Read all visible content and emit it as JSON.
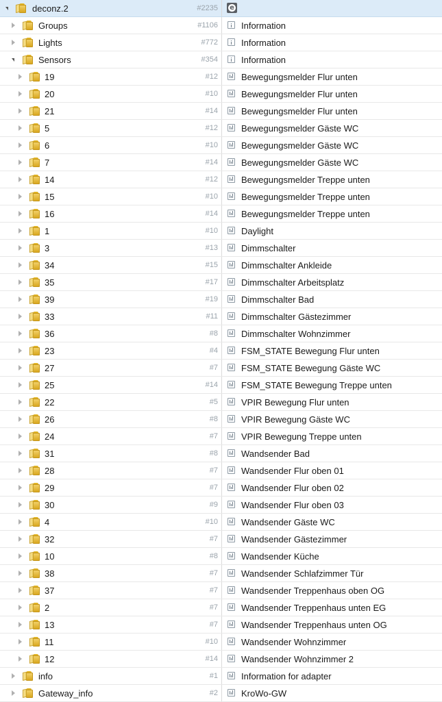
{
  "tree": [
    {
      "name": "deconz.2",
      "count": "#2235",
      "title": "",
      "title_icon": "deconz-logo-icon",
      "level": 0,
      "expanded": true,
      "selected": true
    },
    {
      "name": "Groups",
      "count": "#1106",
      "title": "Information",
      "title_icon": "info-icon",
      "level": 1,
      "expanded": false
    },
    {
      "name": "Lights",
      "count": "#772",
      "title": "Information",
      "title_icon": "info-icon",
      "level": 1,
      "expanded": false
    },
    {
      "name": "Sensors",
      "count": "#354",
      "title": "Information",
      "title_icon": "info-icon",
      "level": 1,
      "expanded": true
    },
    {
      "name": "19",
      "count": "#12",
      "title": "Bewegungsmelder Flur unten",
      "title_icon": "channel-icon",
      "level": 2
    },
    {
      "name": "20",
      "count": "#10",
      "title": "Bewegungsmelder Flur unten",
      "title_icon": "channel-icon",
      "level": 2
    },
    {
      "name": "21",
      "count": "#14",
      "title": "Bewegungsmelder Flur unten",
      "title_icon": "channel-icon",
      "level": 2
    },
    {
      "name": "5",
      "count": "#12",
      "title": "Bewegungsmelder Gäste WC",
      "title_icon": "channel-icon",
      "level": 2
    },
    {
      "name": "6",
      "count": "#10",
      "title": "Bewegungsmelder Gäste WC",
      "title_icon": "channel-icon",
      "level": 2
    },
    {
      "name": "7",
      "count": "#14",
      "title": "Bewegungsmelder Gäste WC",
      "title_icon": "channel-icon",
      "level": 2
    },
    {
      "name": "14",
      "count": "#12",
      "title": "Bewegungsmelder Treppe unten",
      "title_icon": "channel-icon",
      "level": 2
    },
    {
      "name": "15",
      "count": "#10",
      "title": "Bewegungsmelder Treppe unten",
      "title_icon": "channel-icon",
      "level": 2
    },
    {
      "name": "16",
      "count": "#14",
      "title": "Bewegungsmelder Treppe unten",
      "title_icon": "channel-icon",
      "level": 2
    },
    {
      "name": "1",
      "count": "#10",
      "title": "Daylight",
      "title_icon": "channel-icon",
      "level": 2
    },
    {
      "name": "3",
      "count": "#13",
      "title": "Dimmschalter",
      "title_icon": "channel-icon",
      "level": 2
    },
    {
      "name": "34",
      "count": "#15",
      "title": "Dimmschalter Ankleide",
      "title_icon": "channel-icon",
      "level": 2
    },
    {
      "name": "35",
      "count": "#17",
      "title": "Dimmschalter Arbeitsplatz",
      "title_icon": "channel-icon",
      "level": 2
    },
    {
      "name": "39",
      "count": "#19",
      "title": "Dimmschalter Bad",
      "title_icon": "channel-icon",
      "level": 2
    },
    {
      "name": "33",
      "count": "#11",
      "title": "Dimmschalter Gästezimmer",
      "title_icon": "channel-icon",
      "level": 2
    },
    {
      "name": "36",
      "count": "#8",
      "title": "Dimmschalter Wohnzimmer",
      "title_icon": "channel-icon",
      "level": 2
    },
    {
      "name": "23",
      "count": "#4",
      "title": "FSM_STATE Bewegung Flur unten",
      "title_icon": "channel-icon",
      "level": 2
    },
    {
      "name": "27",
      "count": "#7",
      "title": "FSM_STATE Bewegung Gäste WC",
      "title_icon": "channel-icon",
      "level": 2
    },
    {
      "name": "25",
      "count": "#14",
      "title": "FSM_STATE Bewegung Treppe unten",
      "title_icon": "channel-icon",
      "level": 2
    },
    {
      "name": "22",
      "count": "#5",
      "title": "VPIR Bewegung Flur unten",
      "title_icon": "channel-icon",
      "level": 2
    },
    {
      "name": "26",
      "count": "#8",
      "title": "VPIR Bewegung Gäste WC",
      "title_icon": "channel-icon",
      "level": 2
    },
    {
      "name": "24",
      "count": "#7",
      "title": "VPIR Bewegung Treppe unten",
      "title_icon": "channel-icon",
      "level": 2
    },
    {
      "name": "31",
      "count": "#8",
      "title": "Wandsender Bad",
      "title_icon": "channel-icon",
      "level": 2
    },
    {
      "name": "28",
      "count": "#7",
      "title": "Wandsender Flur oben 01",
      "title_icon": "channel-icon",
      "level": 2
    },
    {
      "name": "29",
      "count": "#7",
      "title": "Wandsender Flur oben 02",
      "title_icon": "channel-icon",
      "level": 2
    },
    {
      "name": "30",
      "count": "#9",
      "title": "Wandsender Flur oben 03",
      "title_icon": "channel-icon",
      "level": 2
    },
    {
      "name": "4",
      "count": "#10",
      "title": "Wandsender Gäste WC",
      "title_icon": "channel-icon",
      "level": 2
    },
    {
      "name": "32",
      "count": "#7",
      "title": "Wandsender Gästezimmer",
      "title_icon": "channel-icon",
      "level": 2
    },
    {
      "name": "10",
      "count": "#8",
      "title": "Wandsender Küche",
      "title_icon": "channel-icon",
      "level": 2
    },
    {
      "name": "38",
      "count": "#7",
      "title": "Wandsender Schlafzimmer Tür",
      "title_icon": "channel-icon",
      "level": 2
    },
    {
      "name": "37",
      "count": "#7",
      "title": "Wandsender Treppenhaus oben OG",
      "title_icon": "channel-icon",
      "level": 2
    },
    {
      "name": "2",
      "count": "#7",
      "title": "Wandsender Treppenhaus unten EG",
      "title_icon": "channel-icon",
      "level": 2
    },
    {
      "name": "13",
      "count": "#7",
      "title": "Wandsender Treppenhaus unten OG",
      "title_icon": "channel-icon",
      "level": 2
    },
    {
      "name": "11",
      "count": "#10",
      "title": "Wandsender Wohnzimmer",
      "title_icon": "channel-icon",
      "level": 2
    },
    {
      "name": "12",
      "count": "#14",
      "title": "Wandsender Wohnzimmer 2",
      "title_icon": "channel-icon",
      "level": 2
    },
    {
      "name": "info",
      "count": "#1",
      "title": "Information for adapter",
      "title_icon": "channel-icon",
      "level": 1,
      "expanded": false
    },
    {
      "name": "Gateway_info",
      "count": "#2",
      "title": "KroWo-GW",
      "title_icon": "channel-icon",
      "level": 1,
      "expanded": false
    }
  ],
  "colors": {
    "selected_row": "#dcebf8",
    "count_text": "#9aa3ab",
    "folder": "#e0b325",
    "logo_bg": "#5a5e64"
  },
  "logo_glyph": "e"
}
